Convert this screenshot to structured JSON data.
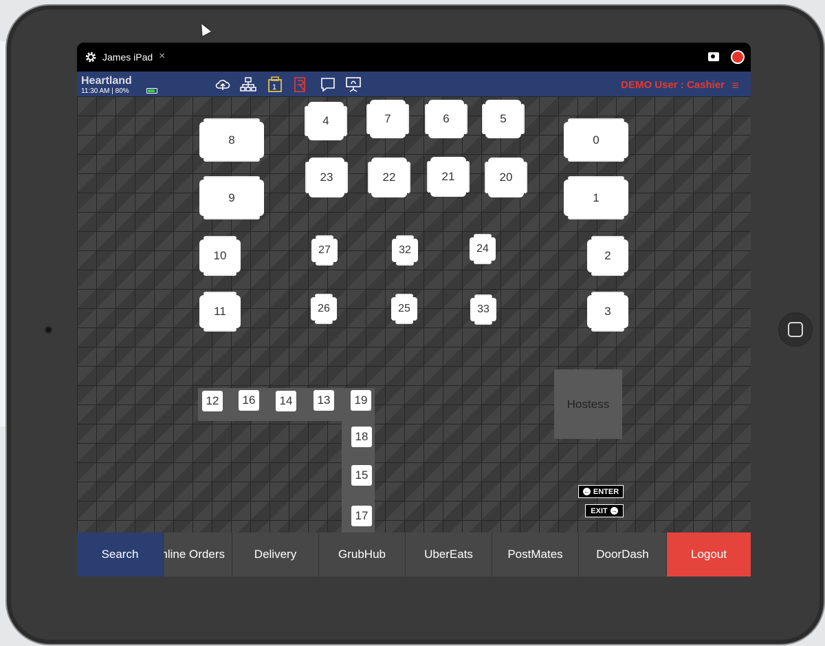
{
  "session": {
    "title": "James iPad",
    "close": "×"
  },
  "header": {
    "brand": "Heartland",
    "time": "11:30 AM",
    "battery_pct": "80%",
    "user": "DEMO User : Cashier",
    "menu_glyph": "≡",
    "icons": [
      "cloud-upload-icon",
      "network-icon",
      "register-icon",
      "gift-card-icon",
      "chat-icon",
      "kds-icon"
    ],
    "register_badge": "1"
  },
  "floor": {
    "tables": {
      "t4": "4",
      "t7": "7",
      "t6": "6",
      "t5": "5",
      "t8": "8",
      "t0": "0",
      "t23": "23",
      "t22": "22",
      "t21": "21",
      "t20": "20",
      "t9": "9",
      "t1": "1",
      "t10": "10",
      "t27": "27",
      "t32": "32",
      "t24": "24",
      "t2": "2",
      "t11": "11",
      "t26": "26",
      "t25": "25",
      "t33": "33",
      "t3": "3"
    },
    "bar": {
      "s12": "12",
      "s16": "16",
      "s14": "14",
      "s13": "13",
      "s19": "19",
      "s18": "18",
      "s15": "15",
      "s17": "17"
    },
    "hostess": "Hostess",
    "enter": "ENTER",
    "exit": "EXIT"
  },
  "bottom": {
    "search": "Search",
    "online_orders": "nline Orders",
    "delivery": "Delivery",
    "grubhub": "GrubHub",
    "ubereats": "UberEats",
    "postmates": "PostMates",
    "doordash": "DoorDash",
    "logout": "Logout"
  },
  "colors": {
    "header_bg": "#2b3e72",
    "logout_bg": "#e5443c",
    "user_text": "#e23a30"
  }
}
